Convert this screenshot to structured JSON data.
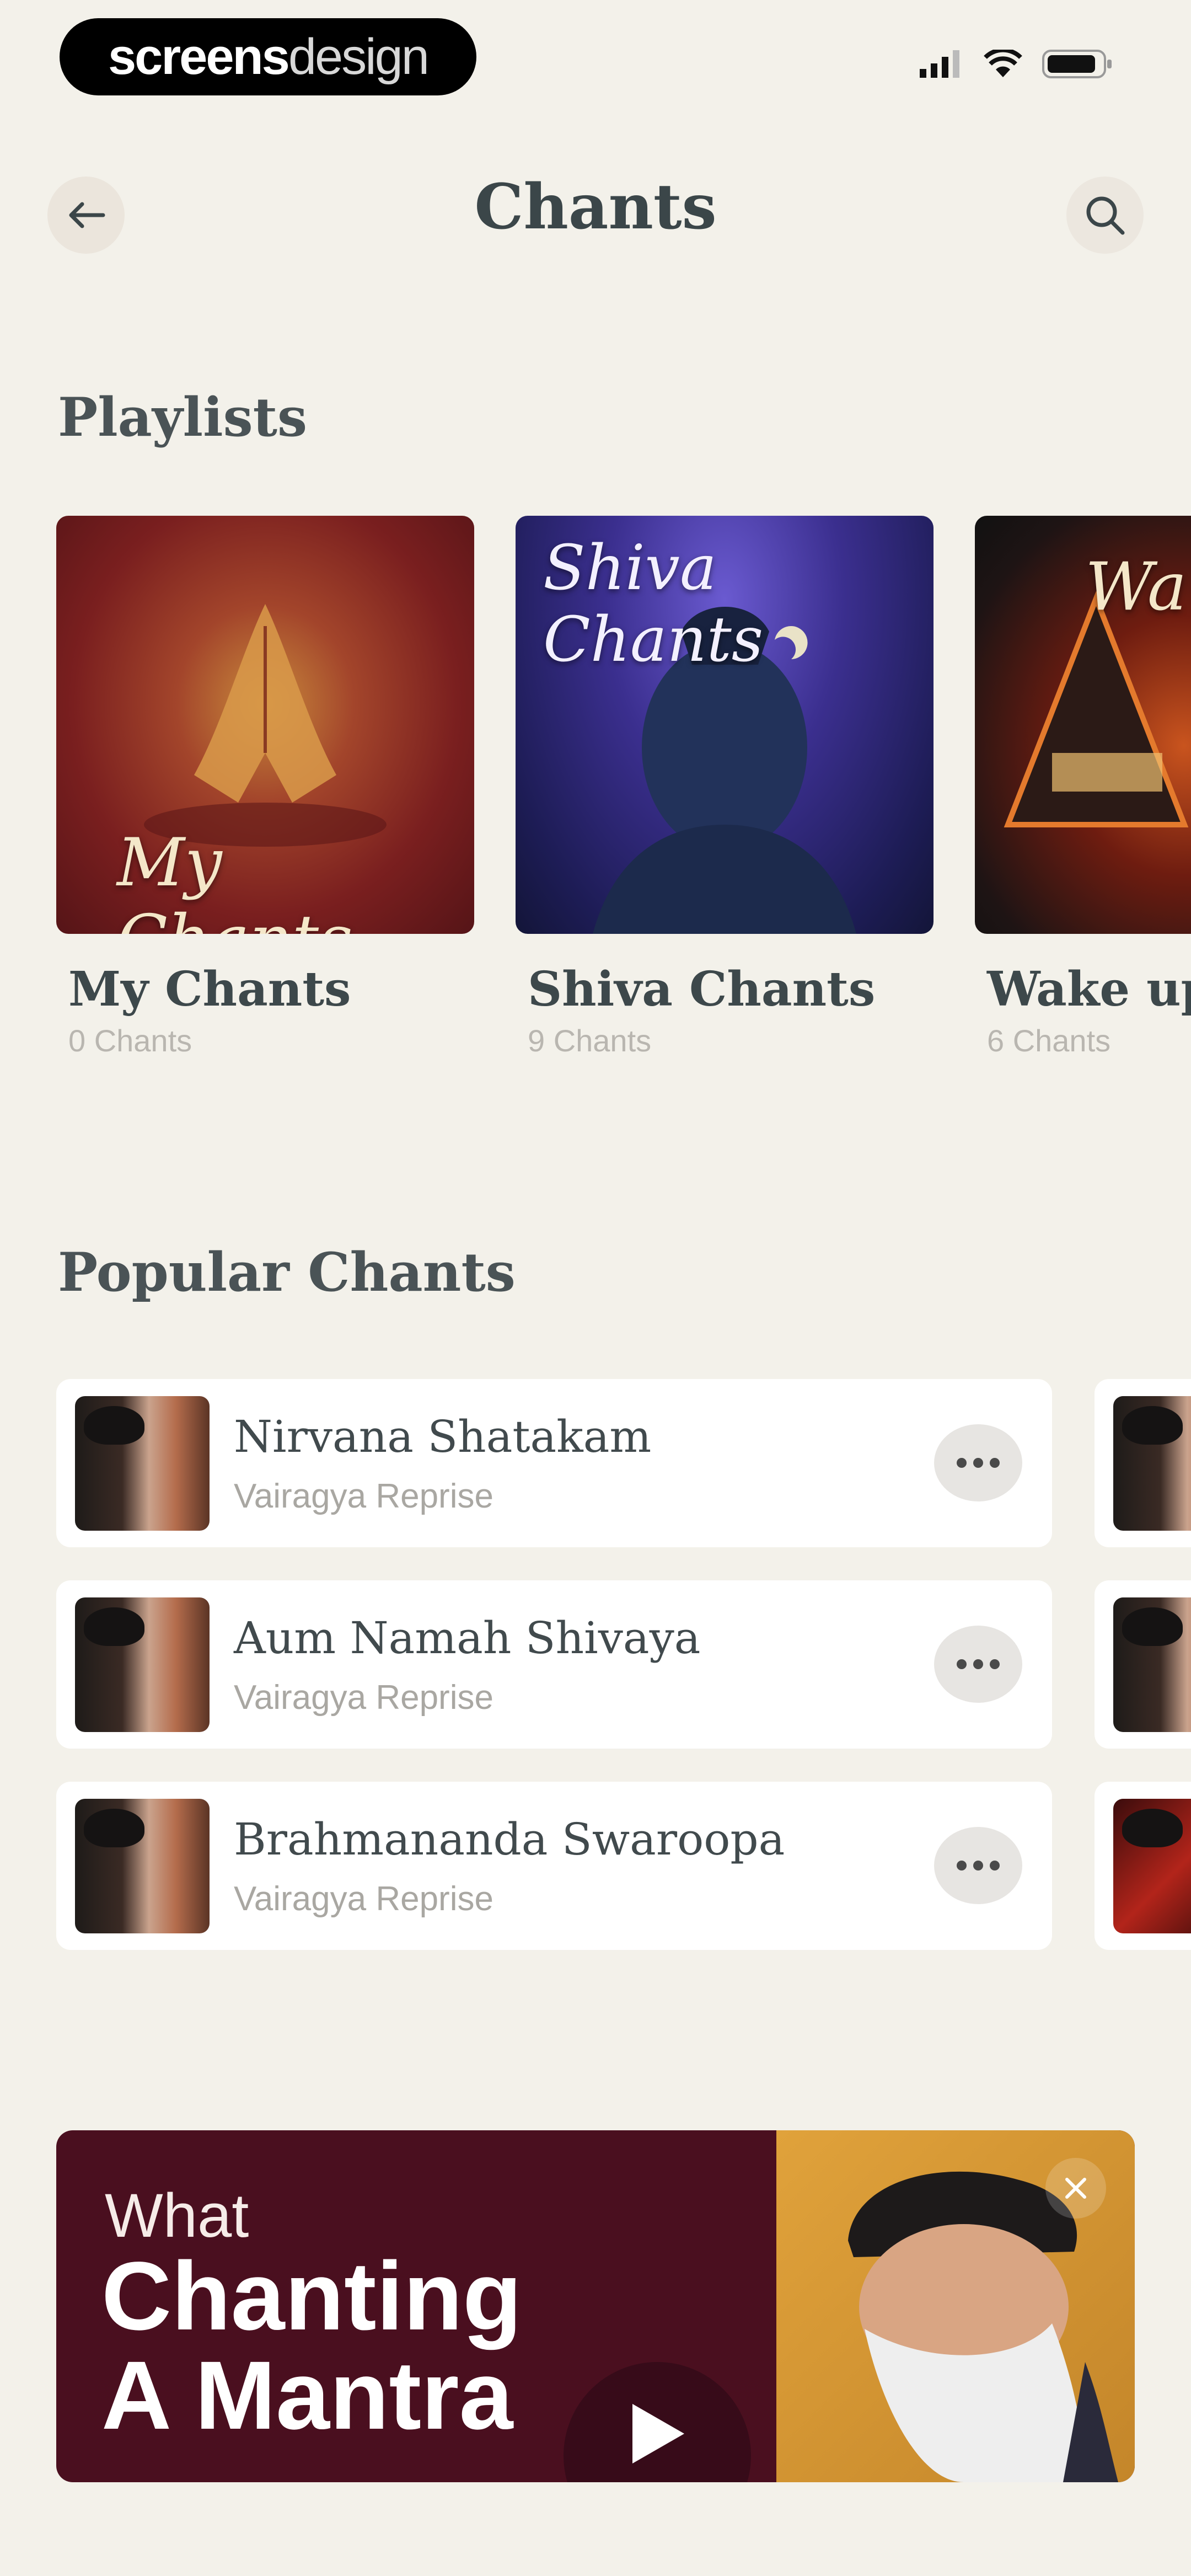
{
  "status_bar": {
    "brand_bold": "screens",
    "brand_light": "design"
  },
  "header": {
    "title": "Chants",
    "back_icon": "arrow-left-icon",
    "search_icon": "search-icon"
  },
  "playlists": {
    "section_title": "Playlists",
    "items": [
      {
        "name": "My Chants",
        "count": "0 Chants",
        "art_text": "My Chants"
      },
      {
        "name": "Shiva Chants",
        "count": "9 Chants",
        "art_text": "Shiva Chants"
      },
      {
        "name": "Wake up",
        "count": "6 Chants",
        "art_text": "Wa"
      }
    ]
  },
  "popular": {
    "section_title": "Popular Chants",
    "items": [
      {
        "title": "Nirvana Shatakam",
        "artist": "Vairagya Reprise"
      },
      {
        "title": "Aum Namah Shivaya",
        "artist": "Vairagya Reprise"
      },
      {
        "title": "Brahmananda Swaroopa",
        "artist": "Vairagya Reprise"
      }
    ]
  },
  "promo": {
    "line_small": "What",
    "line_big_1": "Chanting",
    "line_big_2": "A Mantra",
    "play_icon": "play-icon",
    "close_icon": "close-icon"
  },
  "colors": {
    "background": "#f3f1ea",
    "title_text": "#3b4649",
    "promo_maroon": "#4a0f1f",
    "promo_gold": "#e0a23b"
  }
}
